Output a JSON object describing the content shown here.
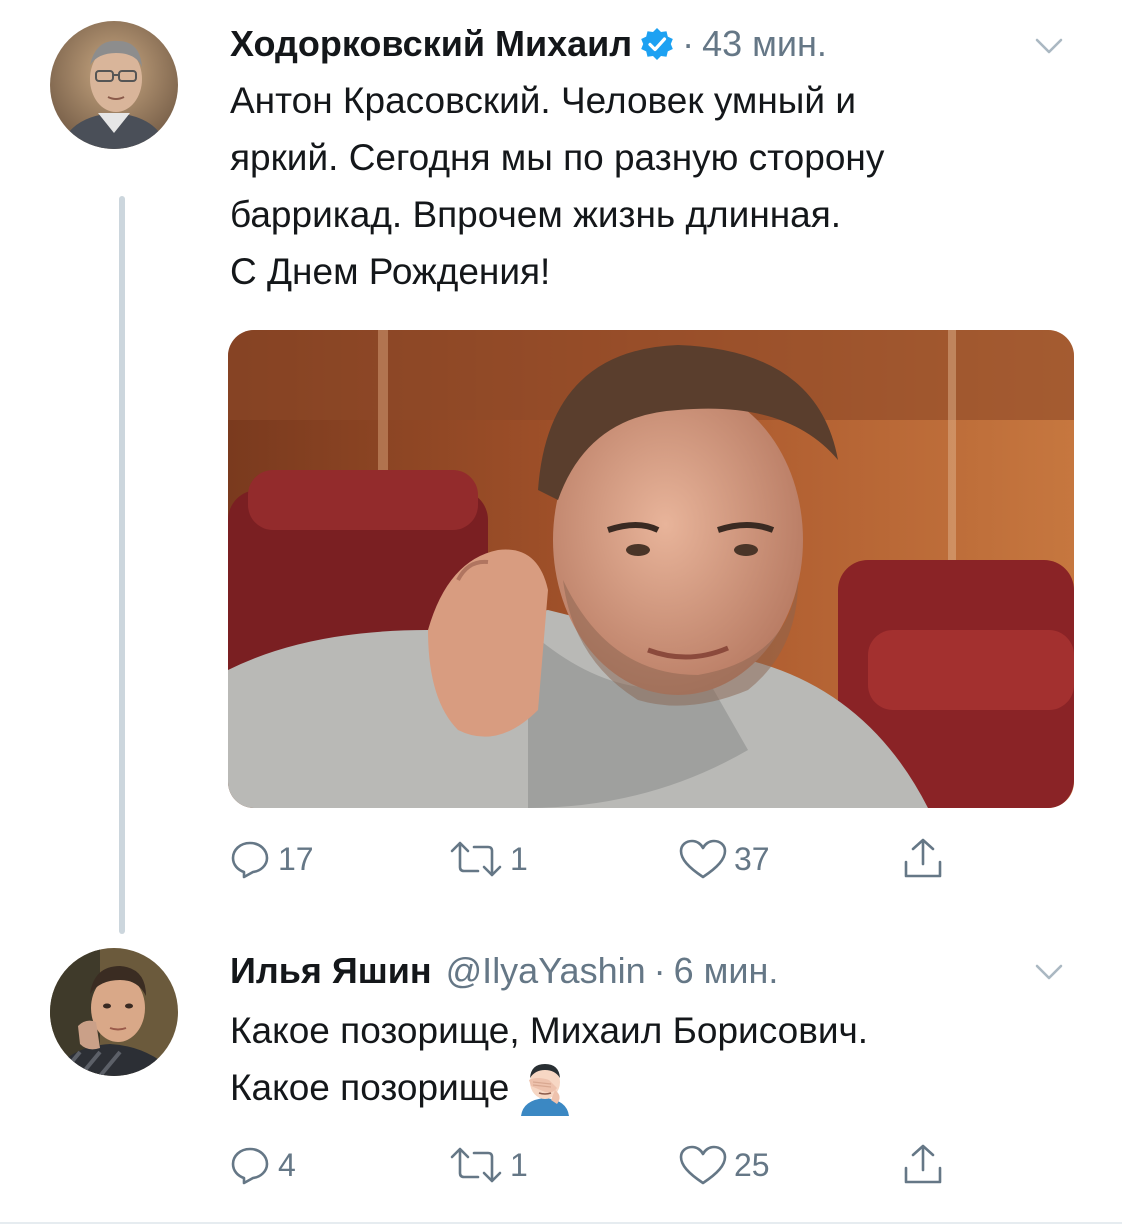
{
  "tweet1": {
    "author_name": "Ходорковский Михаил",
    "verified": true,
    "separator": "·",
    "time": "43 мин.",
    "text": "Антон Красовский. Человек умный и\nяркий. Сегодня мы по разную сторону\nбаррикад. Впрочем жизнь длинная.\nС Днем Рождения!",
    "actions": {
      "replies": "17",
      "retweets": "1",
      "likes": "37"
    }
  },
  "tweet2": {
    "author_name": "Илья Яшин",
    "handle": "@IlyaYashin",
    "separator": "·",
    "time": "6 мин.",
    "text_line1": "Какое позорище, Михаил Борисович.",
    "text_line2": "Какое позорище",
    "emoji": "facepalm-emoji",
    "actions": {
      "replies": "4",
      "retweets": "1",
      "likes": "25"
    }
  },
  "colors": {
    "text": "#14171a",
    "secondary": "#657786",
    "verified": "#1da1f2",
    "thread_line": "#ccd6dd"
  }
}
